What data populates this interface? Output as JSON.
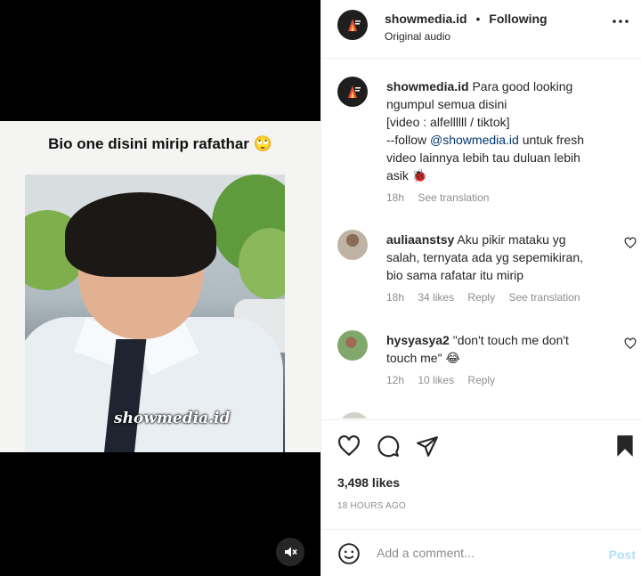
{
  "media": {
    "caption_overlay": "Bio one disini mirip rafathar",
    "watermark": "showmedia.id",
    "mute_icon": "speaker-muted-icon"
  },
  "header": {
    "username": "showmedia.id",
    "separator": "•",
    "follow_status": "Following",
    "subtitle": "Original audio",
    "more_icon": "more-horizontal-icon"
  },
  "post_caption": {
    "username": "showmedia.id",
    "line1": "Para good looking",
    "line2": "ngumpul semua disini",
    "line3": "[video : alfellllll / tiktok]",
    "line4_pre": "--follow ",
    "line4_mention": "@showmedia.id",
    "line4_post": " untuk fresh",
    "line5": "video lainnya lebih tau duluan lebih",
    "line6": "asik",
    "time": "18h",
    "see_translation": "See translation"
  },
  "comments": [
    {
      "username": "auliaanstsy",
      "line1": "Aku pikir mataku yg",
      "line2": "salah, ternyata ada yg sepemikiran,",
      "line3": "bio sama rafatar itu mirip",
      "time": "18h",
      "likes": "34 likes",
      "reply": "Reply",
      "see_translation": "See translation"
    },
    {
      "username": "hysyasya2",
      "line1": "\"don't touch me don't",
      "line2": "touch me\"",
      "time": "12h",
      "likes": "10 likes",
      "reply": "Reply"
    }
  ],
  "actions": {
    "like_icon": "heart-icon",
    "comment_icon": "comment-icon",
    "share_icon": "share-icon",
    "save_icon": "bookmark-icon",
    "likes_count": "3,498 likes",
    "timestamp": "18 HOURS AGO"
  },
  "add_comment": {
    "emoji_icon": "emoji-icon",
    "placeholder": "Add a comment...",
    "post_label": "Post"
  },
  "colors": {
    "mention": "#00376b",
    "meta_grey": "#8e8e8e",
    "post_disabled": "#b2dffc"
  }
}
